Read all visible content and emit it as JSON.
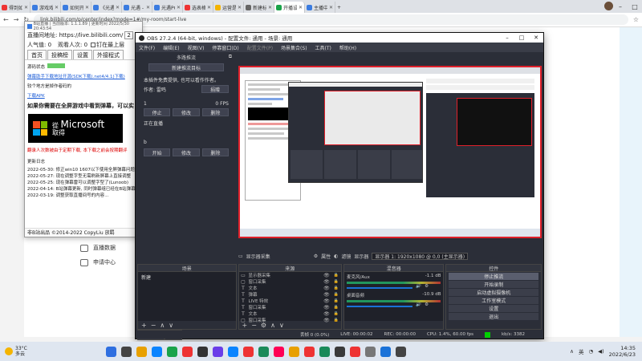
{
  "browser": {
    "tabs": [
      {
        "label": "得到如此",
        "color": "#e33"
      },
      {
        "label": "游戏戏",
        "color": "#3a7be0"
      },
      {
        "label": "如何开",
        "color": "#3a7be0"
      },
      {
        "label": "《光遇》",
        "color": "#3a7be0"
      },
      {
        "label": "光遇 -",
        "color": "#3a7be0"
      },
      {
        "label": "光遇PC",
        "color": "#3a7be0"
      },
      {
        "label": "选表格",
        "color": "#e33"
      },
      {
        "label": "运营是",
        "color": "#f4b400"
      },
      {
        "label": "新建标",
        "color": "#666"
      },
      {
        "label": "开播设",
        "color": "#1aa34a"
      },
      {
        "label": "主播中心",
        "color": "#3a7be0"
      }
    ],
    "active_tab_index": 9,
    "url": "link.bilibili.com/p/center/index?mode=1#/my-room/start-live",
    "new_tab_label": "+"
  },
  "helper": {
    "title": "B站直播 | 当前版本: 1.1.1.89 | 更新时间 2022/5/30 20:43:54",
    "live_address_label": "直播间地址: https://live.bilibili.com/",
    "live_address_value": "2",
    "popularity": "人气值: 0",
    "viewers": "观看人次: 0",
    "pin_label": "钉在最上层",
    "menu": [
      "首页",
      "投稿榜",
      "设置",
      "外接程式"
    ],
    "source_status": "源码状态",
    "tool_link": "弹幕助手下载地址开源(SDK下载(.net4/4.1)下载)",
    "lost_text": "较个地方是掉作者码的",
    "apk_link": "下载APK",
    "tip": "如果你需要在全屏游戏中看到弹幕，可以实",
    "ms_from": "從",
    "ms_get": "取得",
    "ms_brand": "Microsoft",
    "warning": "翻录人次数被由于定期下载, 本下载之前会按期翻评",
    "changelog_title": "更新日志",
    "changelog": [
      "2022-05-30: 修正win10 1607以下使用全屏弹幕问题",
      "2022-05-27: 现在调整字型无需刷新屏幕上直接调整",
      "2022-05-25: 现在弹幕雷可以调整字型了(Lunoob)",
      "2022-04-14: B站弹幕更新, 同时弹幕组已经在B站弹幕",
      "2022-03-19: 调整获取直播间号的内容..."
    ],
    "footer": "非B站出品 ©2014-2022 CopyLiu 放羁"
  },
  "bg_menu": [
    "直播数据",
    "申请中心"
  ],
  "obs": {
    "title": "OBS 27.2.4 (64-bit, windows) - 配置文件: 通用 - 场景: 通用",
    "menu": [
      "文件(F)",
      "编辑(E)",
      "视图(V)",
      "停靠窗口(D)",
      "配置文件(P)",
      "场景集合(S)",
      "工具(T)",
      "帮助(H)"
    ],
    "dock": {
      "header": "多路推流",
      "new_target": "新建推流目标",
      "desc": "本插件免费提供, 也可以看作作者。",
      "author": "作者: 雷鸣",
      "donate": "捐赠",
      "rows": [
        {
          "name": "1",
          "fps": "0 FPS",
          "buttons": [
            "停止",
            "修改",
            "删除"
          ]
        },
        {
          "name": "",
          "fps": "",
          "buttons": []
        }
      ],
      "status": "正在直播",
      "bilibili_label": "b",
      "start_buttons": [
        "开始",
        "修改",
        "删除"
      ]
    },
    "preview_bar": {
      "source": "显示器采集",
      "properties": "属性",
      "filters": "滤镜",
      "display_label": "显示器",
      "display_value": "显示器 1: 1920x1080 @ 0,0 (主显示器)"
    },
    "panels": {
      "scenes": {
        "title": "场景",
        "items": [
          "新建"
        ]
      },
      "sources": {
        "title": "来源",
        "items": [
          {
            "icon": "monitor",
            "label": "显示器采集"
          },
          {
            "icon": "window",
            "label": "窗口采集"
          },
          {
            "icon": "text",
            "label": "文本"
          },
          {
            "icon": "text",
            "label": "弹幕"
          },
          {
            "icon": "text",
            "label": "LIVE 特效"
          },
          {
            "icon": "text",
            "label": "窗口采集"
          },
          {
            "icon": "text",
            "label": "文本"
          },
          {
            "icon": "window",
            "label": "窗口采集"
          }
        ]
      },
      "mixer": {
        "title": "混音器",
        "channels": [
          {
            "name": "麦克风/Aux",
            "db": "-1.1 dB"
          },
          {
            "name": "桌面音频",
            "db": "-10.9 dB"
          }
        ]
      },
      "controls": {
        "title": "控件",
        "buttons": [
          "停止推流",
          "开始录制",
          "启动虚拟摄像机",
          "工作室模式",
          "设置",
          "退出"
        ]
      }
    },
    "dock_tabs": [
      "转场动画",
      "场景"
    ],
    "status": {
      "dropped": "丢帧 0 (0.0%)",
      "live": "LIVE: 00:00:02",
      "rec": "REC: 00:00:00",
      "cpu": "CPU: 1.4%, 60.00 fps",
      "kbps": "kb/s: 3382"
    }
  },
  "taskbar": {
    "temp": "33°C",
    "weather": "多云",
    "ime": "英",
    "time": "14:35",
    "date": "2022/6/23",
    "app_colors": [
      "#2f6fe0",
      "#444",
      "#e8a000",
      "#0a84ff",
      "#1aa34a",
      "#e33",
      "#333",
      "#6a3de8",
      "#0a84ff",
      "#e33",
      "#1a8a5a",
      "#f05",
      "#e8a000",
      "#e33",
      "#1a8a5a",
      "#3a3a3a",
      "#e33",
      "#777",
      "#1a72d8",
      "#444"
    ]
  }
}
